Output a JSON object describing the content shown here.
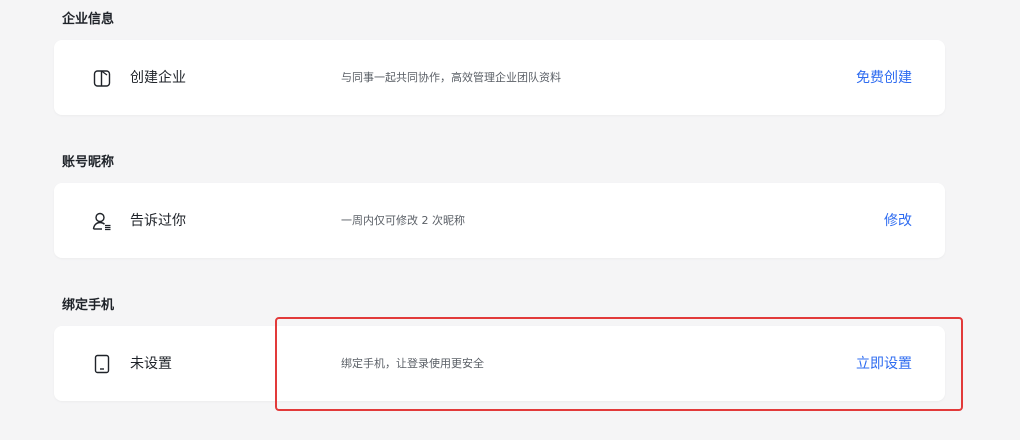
{
  "sections": [
    {
      "title": "企业信息",
      "item": {
        "icon": "building-icon",
        "name": "创建企业",
        "description": "与同事一起共同协作，高效管理企业团队资料",
        "action": "免费创建"
      }
    },
    {
      "title": "账号昵称",
      "item": {
        "icon": "user-icon",
        "name": "告诉过你",
        "description": "一周内仅可修改 2 次昵称",
        "action": "修改"
      }
    },
    {
      "title": "绑定手机",
      "item": {
        "icon": "phone-icon",
        "name": "未设置",
        "description": "绑定手机，让登录使用更安全",
        "action": "立即设置"
      }
    }
  ],
  "colors": {
    "accent": "#2f6cf0",
    "highlight": "#e23a3a",
    "background": "#f5f5f6"
  }
}
